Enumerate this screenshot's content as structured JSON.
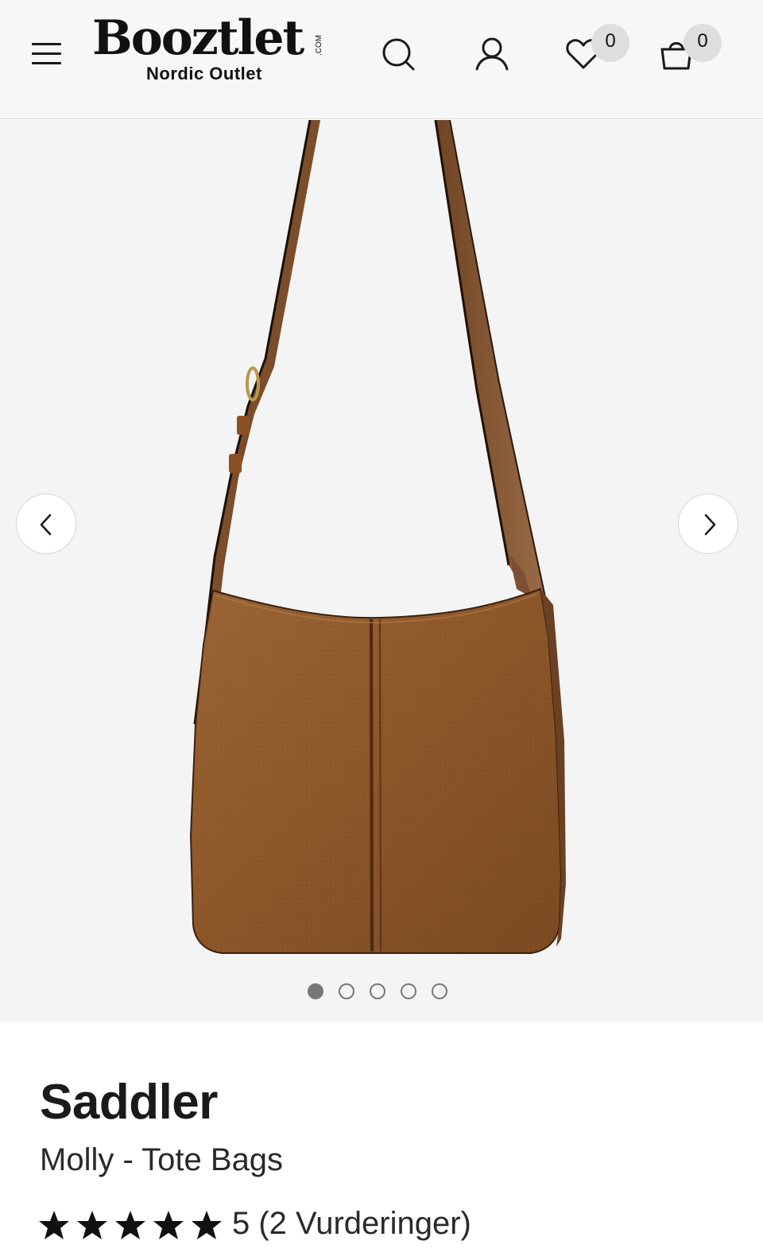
{
  "header": {
    "logo_text": "Booztlet",
    "logo_com": ".COM",
    "logo_sub": "Nordic Outlet",
    "wishlist_count": "0",
    "cart_count": "0"
  },
  "icons": {
    "menu": "hamburger-icon",
    "search": "search-icon",
    "account": "user-icon",
    "wishlist": "heart-icon",
    "cart": "shopping-bag-icon",
    "prev": "chevron-left-icon",
    "next": "chevron-right-icon",
    "star": "star-icon"
  },
  "gallery": {
    "image_description": "Brown leather shoulder tote bag",
    "total_images": 5,
    "active_index": 0
  },
  "product": {
    "brand": "Saddler",
    "name": "Molly - Tote Bags",
    "rating_value": 5,
    "rating_stars": 5,
    "rating_text": "5 (2 Vurderinger)"
  },
  "colors": {
    "header_bg": "#f7f7f7",
    "gallery_bg": "#f4f4f4",
    "leather": "#8f5a2c",
    "badge_bg": "#dedede"
  }
}
